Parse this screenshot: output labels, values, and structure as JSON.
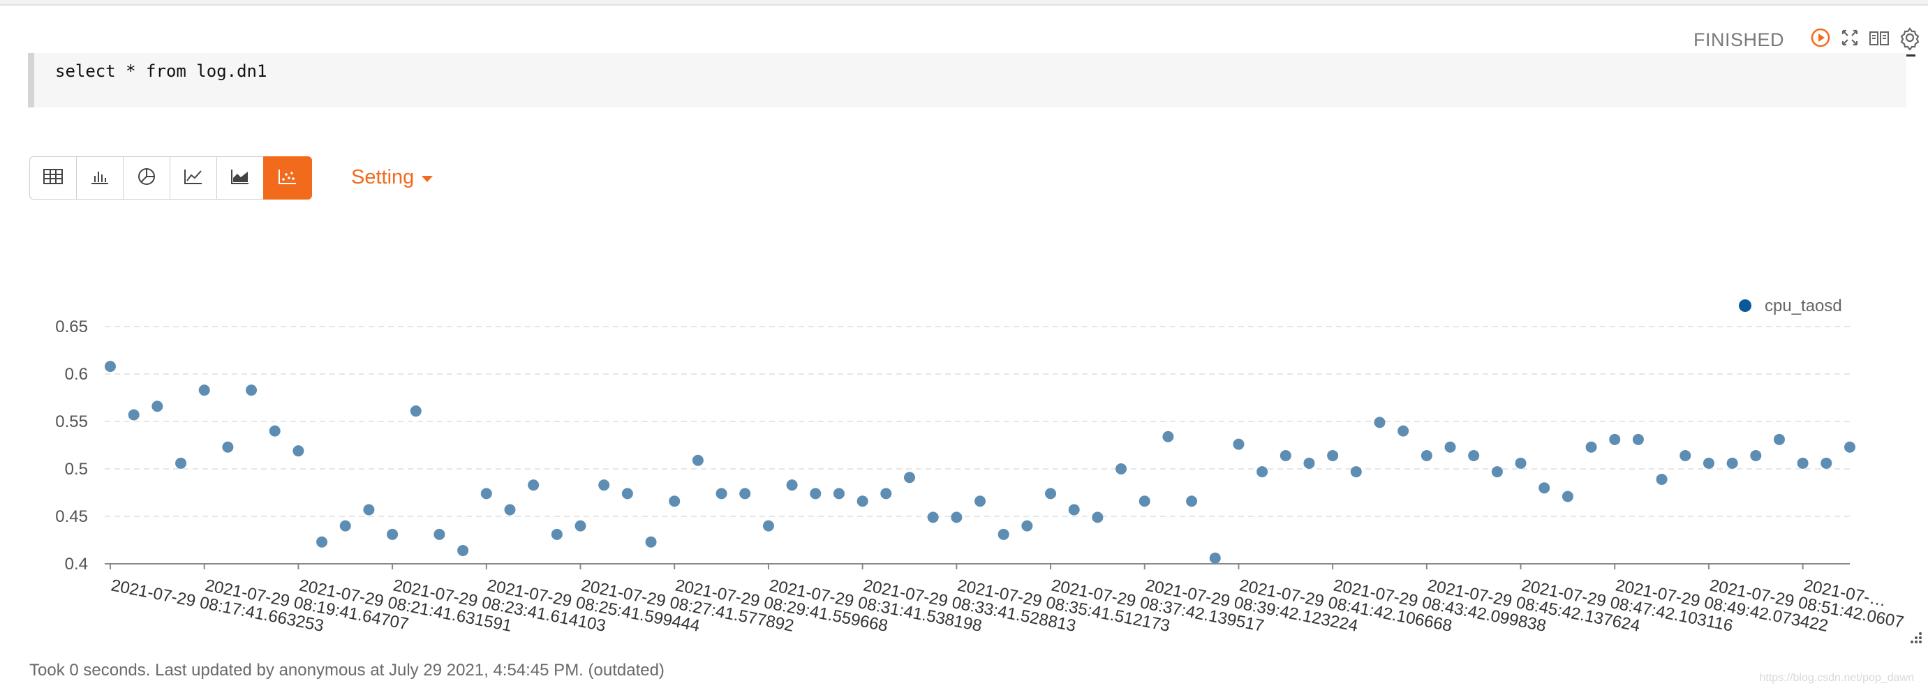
{
  "paragraph": {
    "status": "FINISHED",
    "code": "select * from log.dn1",
    "setting_label": "Setting",
    "footer": "Took 0 seconds. Last updated by anonymous at July 29 2021, 4:54:45 PM. (outdated)",
    "watermark": "https://blog.csdn.net/pop_dawn",
    "toolbar_icons": [
      "run-icon",
      "expand-icon",
      "book-icon",
      "gear-icon"
    ],
    "viz_modes": [
      {
        "icon": "table-icon",
        "active": false
      },
      {
        "icon": "bar-chart-icon",
        "active": false
      },
      {
        "icon": "pie-chart-icon",
        "active": false
      },
      {
        "icon": "line-chart-icon",
        "active": false
      },
      {
        "icon": "area-chart-icon",
        "active": false
      },
      {
        "icon": "scatter-chart-icon",
        "active": true
      }
    ],
    "colors": {
      "accent": "#f26b1d",
      "point": "#5d8db2",
      "legend_dot": "#08589a"
    }
  },
  "chart_data": {
    "type": "scatter",
    "series": [
      {
        "name": "cpu_taosd",
        "values": [
          0.608,
          0.557,
          0.566,
          0.506,
          0.583,
          0.523,
          0.583,
          0.54,
          0.519,
          0.423,
          0.44,
          0.457,
          0.431,
          0.561,
          0.431,
          0.414,
          0.474,
          0.457,
          0.483,
          0.431,
          0.44,
          0.483,
          0.474,
          0.423,
          0.466,
          0.509,
          0.474,
          0.474,
          0.44,
          0.483,
          0.474,
          0.474,
          0.466,
          0.474,
          0.491,
          0.449,
          0.449,
          0.466,
          0.431,
          0.44,
          0.474,
          0.457,
          0.449,
          0.5,
          0.466,
          0.534,
          0.466,
          0.406,
          0.526,
          0.497,
          0.514,
          0.506,
          0.514,
          0.497,
          0.549,
          0.54,
          0.514,
          0.523,
          0.514,
          0.497,
          0.506,
          0.48,
          0.471,
          0.523,
          0.531,
          0.531,
          0.489,
          0.514,
          0.506,
          0.506,
          0.514,
          0.531,
          0.506,
          0.506,
          0.523
        ]
      }
    ],
    "x_tick_labels": [
      "2021-07-29 08:17:41.663253",
      "2021-07-29 08:19:41.64707",
      "2021-07-29 08:21:41.631591",
      "2021-07-29 08:23:41.614103",
      "2021-07-29 08:25:41.599444",
      "2021-07-29 08:27:41.577892",
      "2021-07-29 08:29:41.559668",
      "2021-07-29 08:31:41.538198",
      "2021-07-29 08:33:41.528813",
      "2021-07-29 08:35:41.512173",
      "2021-07-29 08:37:42.139517",
      "2021-07-29 08:39:42.123224",
      "2021-07-29 08:41:42.106668",
      "2021-07-29 08:43:42.099838",
      "2021-07-29 08:45:42.137624",
      "2021-07-29 08:47:42.103116",
      "2021-07-29 08:49:42.073422",
      "2021-07-29 08:51:42.0607",
      "2021-07-…"
    ],
    "y_ticks": [
      "0.4",
      "0.45",
      "0.5",
      "0.55",
      "0.6",
      "0.65"
    ],
    "ylim": [
      0.4,
      0.65
    ],
    "grid": true,
    "legend_position": "top-right"
  }
}
